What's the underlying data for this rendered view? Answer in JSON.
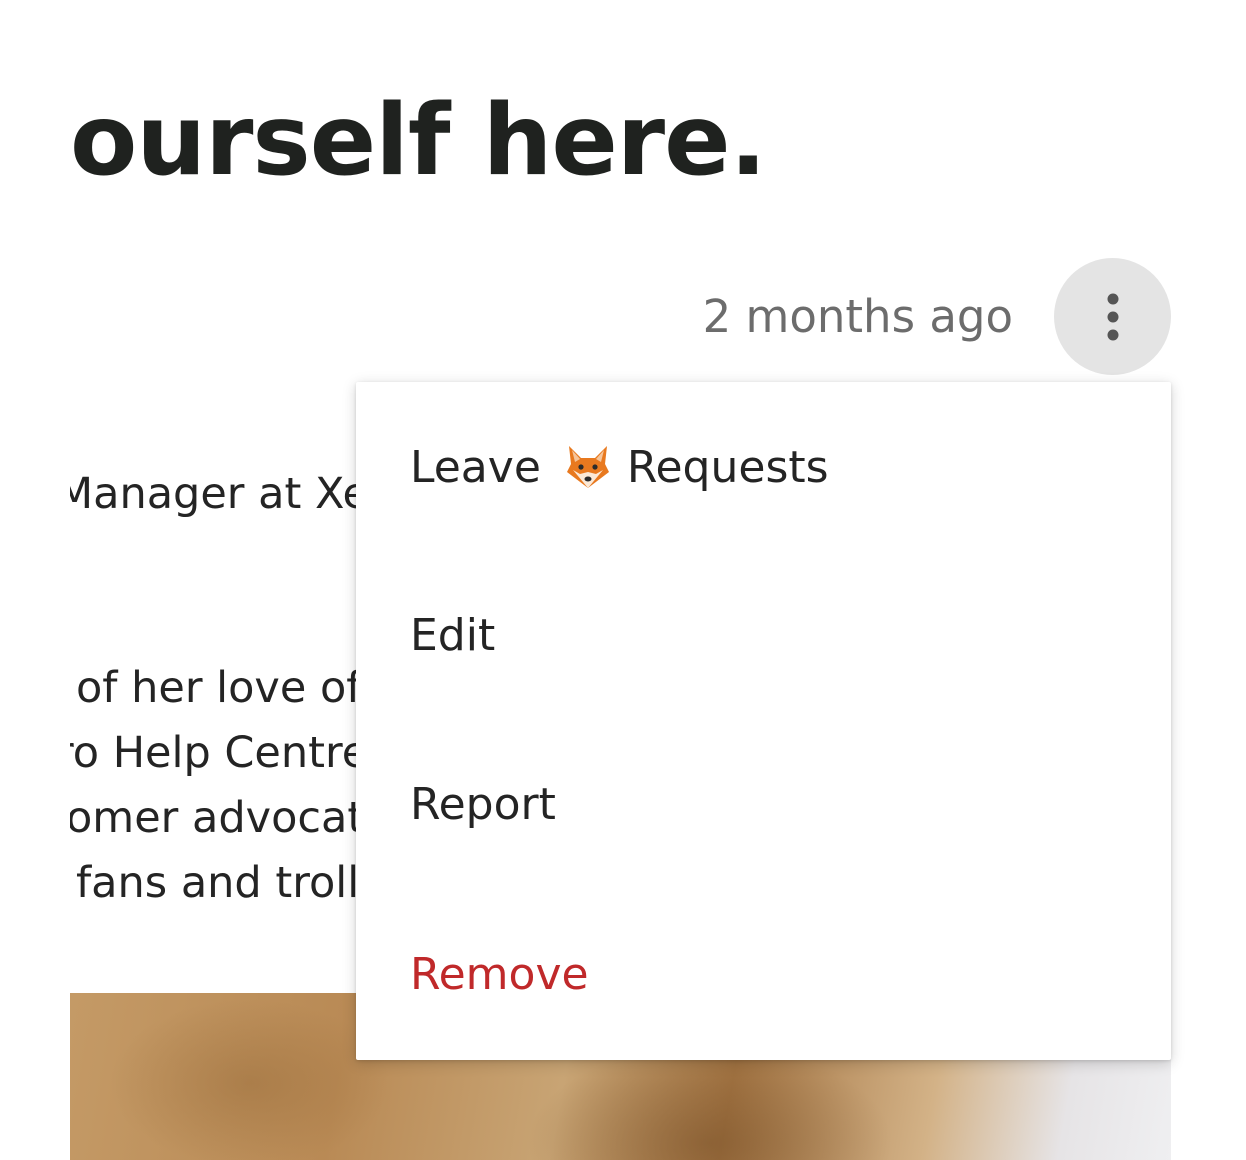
{
  "header": {
    "title": "ourself here."
  },
  "post": {
    "timestamp": "2 months ago",
    "more_icon": "vertical-dots-icon",
    "role_line": "Manager at Xe",
    "bio_lines": [
      "of her love of",
      "ro Help Centre",
      "omer advocat",
      "fans and troll"
    ]
  },
  "menu": {
    "items": [
      {
        "label_before": "Leave",
        "emoji": "fox-face-icon",
        "label_after": "Requests"
      },
      {
        "label": "Edit"
      },
      {
        "label": "Report"
      },
      {
        "label": "Remove",
        "color": "#c0292a"
      }
    ]
  },
  "colors": {
    "title": "#1f221f",
    "timestamp": "#6c6c6c",
    "menu_text": "#242424",
    "danger": "#c0292a",
    "more_button_bg": "#e4e4e4"
  }
}
